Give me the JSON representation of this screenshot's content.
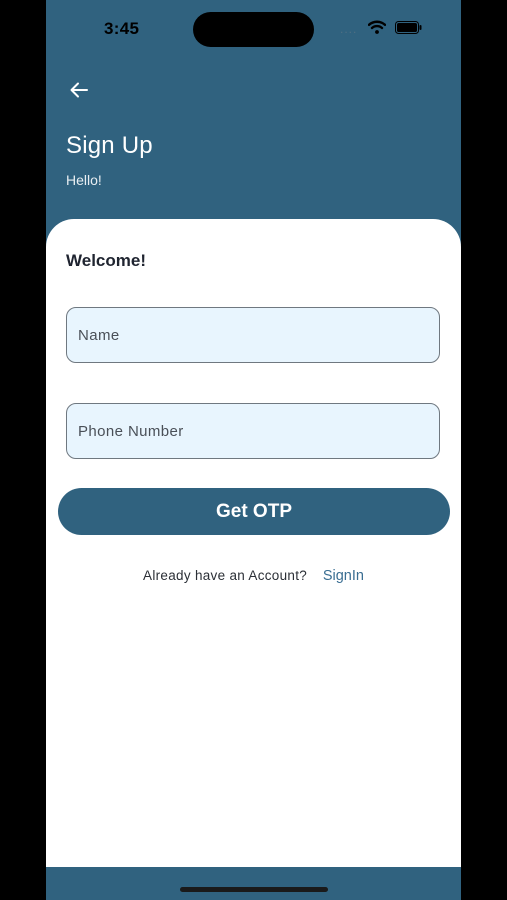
{
  "status_bar": {
    "time": "3:45",
    "signal_indicator": "....",
    "icons": [
      "wifi-icon",
      "battery-icon"
    ]
  },
  "header": {
    "back_icon": "arrow-left-icon",
    "title": "Sign Up",
    "subtitle": "Hello!"
  },
  "form": {
    "welcome": "Welcome!",
    "name_field": {
      "placeholder": "Name",
      "value": ""
    },
    "phone_field": {
      "placeholder": "Phone Number",
      "value": ""
    },
    "submit_label": "Get OTP"
  },
  "footer": {
    "prompt": "Already have an Account?",
    "link_label": "SignIn"
  },
  "colors": {
    "primary": "#30627f",
    "field_background": "#e8f5fe",
    "card": "#ffffff",
    "link": "#3a6e92"
  }
}
